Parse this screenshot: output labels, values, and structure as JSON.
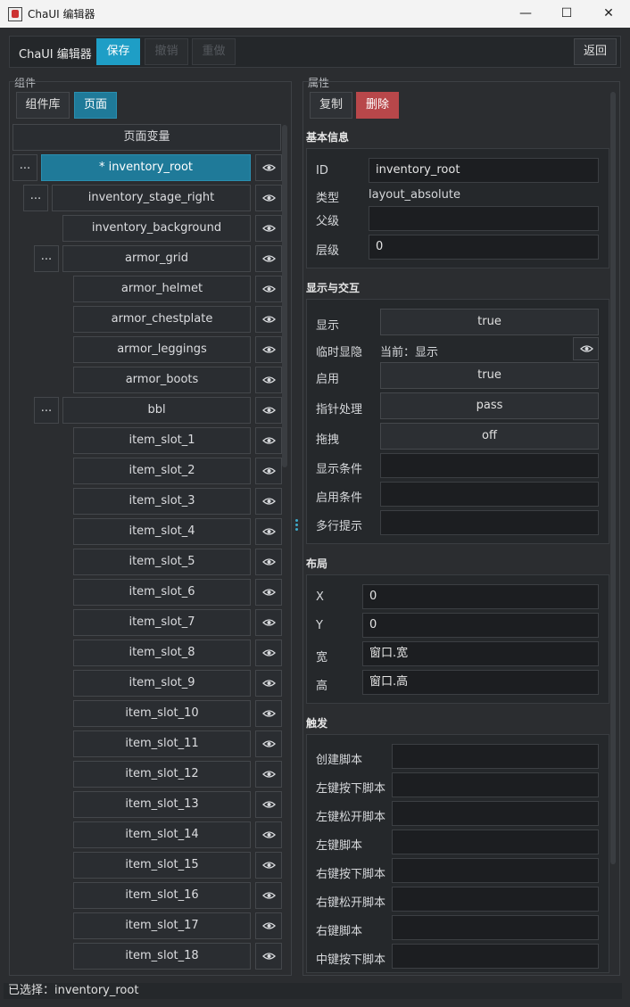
{
  "window": {
    "title": "ChaUI 编辑器",
    "minimize": "—",
    "maximize": "☐",
    "close": "✕"
  },
  "toolbar": {
    "app_label": "ChaUI 编辑器",
    "save": "保存",
    "undo": "撤销",
    "redo": "重做",
    "back": "返回"
  },
  "left": {
    "group_label": "组件",
    "tabs": {
      "library": "组件库",
      "page": "页面"
    },
    "page_vars": "页面变量",
    "tree": [
      {
        "label": "* inventory_root",
        "depth": 0,
        "has_children": true,
        "selected": true
      },
      {
        "label": "inventory_stage_right",
        "depth": 1,
        "has_children": true
      },
      {
        "label": "inventory_background",
        "depth": 2,
        "has_children": false
      },
      {
        "label": "armor_grid",
        "depth": 2,
        "has_children": true
      },
      {
        "label": "armor_helmet",
        "depth": 3,
        "has_children": false
      },
      {
        "label": "armor_chestplate",
        "depth": 3,
        "has_children": false
      },
      {
        "label": "armor_leggings",
        "depth": 3,
        "has_children": false
      },
      {
        "label": "armor_boots",
        "depth": 3,
        "has_children": false
      },
      {
        "label": "bbl",
        "depth": 2,
        "has_children": true
      },
      {
        "label": "item_slot_1",
        "depth": 3,
        "has_children": false
      },
      {
        "label": "item_slot_2",
        "depth": 3,
        "has_children": false
      },
      {
        "label": "item_slot_3",
        "depth": 3,
        "has_children": false
      },
      {
        "label": "item_slot_4",
        "depth": 3,
        "has_children": false
      },
      {
        "label": "item_slot_5",
        "depth": 3,
        "has_children": false
      },
      {
        "label": "item_slot_6",
        "depth": 3,
        "has_children": false
      },
      {
        "label": "item_slot_7",
        "depth": 3,
        "has_children": false
      },
      {
        "label": "item_slot_8",
        "depth": 3,
        "has_children": false
      },
      {
        "label": "item_slot_9",
        "depth": 3,
        "has_children": false
      },
      {
        "label": "item_slot_10",
        "depth": 3,
        "has_children": false
      },
      {
        "label": "item_slot_11",
        "depth": 3,
        "has_children": false
      },
      {
        "label": "item_slot_12",
        "depth": 3,
        "has_children": false
      },
      {
        "label": "item_slot_13",
        "depth": 3,
        "has_children": false
      },
      {
        "label": "item_slot_14",
        "depth": 3,
        "has_children": false
      },
      {
        "label": "item_slot_15",
        "depth": 3,
        "has_children": false
      },
      {
        "label": "item_slot_16",
        "depth": 3,
        "has_children": false
      },
      {
        "label": "item_slot_17",
        "depth": 3,
        "has_children": false
      },
      {
        "label": "item_slot_18",
        "depth": 3,
        "has_children": false
      }
    ],
    "expand_label": "...",
    "eye_icon": "eye-icon"
  },
  "right": {
    "group_label": "属性",
    "copy": "复制",
    "delete": "删除",
    "basic": {
      "title": "基本信息",
      "id_label": "ID",
      "id_value": "inventory_root",
      "type_label": "类型",
      "type_value": "layout_absolute",
      "parent_label": "父级",
      "parent_value": "",
      "layer_label": "层级",
      "layer_value": "0"
    },
    "display": {
      "title": "显示与交互",
      "visible_label": "显示",
      "visible_value": "true",
      "temp_label": "临时显隐",
      "temp_value": "当前：显示",
      "enabled_label": "启用",
      "enabled_value": "true",
      "pointer_label": "指针处理",
      "pointer_value": "pass",
      "drag_label": "拖拽",
      "drag_value": "off",
      "show_cond_label": "显示条件",
      "show_cond_value": "",
      "enable_cond_label": "启用条件",
      "enable_cond_value": "",
      "tooltip_label": "多行提示",
      "tooltip_value": ""
    },
    "layout": {
      "title": "布局",
      "x_label": "X",
      "x_value": "0",
      "y_label": "Y",
      "y_value": "0",
      "w_label": "宽",
      "w_value": "窗口.宽",
      "h_label": "高",
      "h_value": "窗口.高"
    },
    "triggers": {
      "title": "触发",
      "items": [
        {
          "label": "创建脚本",
          "value": ""
        },
        {
          "label": "左键按下脚本",
          "value": ""
        },
        {
          "label": "左键松开脚本",
          "value": ""
        },
        {
          "label": "左键脚本",
          "value": ""
        },
        {
          "label": "右键按下脚本",
          "value": ""
        },
        {
          "label": "右键松开脚本",
          "value": ""
        },
        {
          "label": "右键脚本",
          "value": ""
        },
        {
          "label": "中键按下脚本",
          "value": ""
        }
      ]
    }
  },
  "status": {
    "text": "已选择：inventory_root"
  },
  "colors": {
    "accent": "#1e9ec6",
    "selected": "#1f7a99",
    "danger": "#b8474a",
    "background": "#2b2d30"
  }
}
